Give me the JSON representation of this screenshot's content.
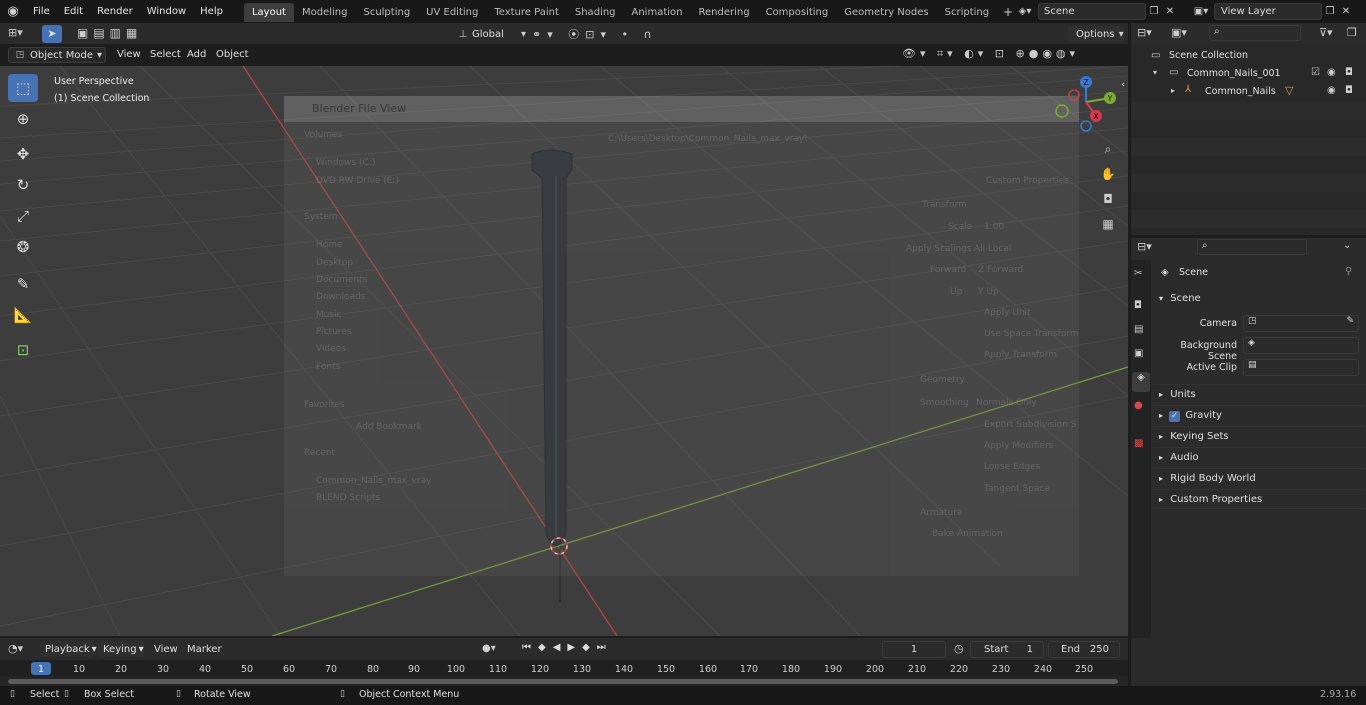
{
  "topbar": {
    "menus": [
      "File",
      "Edit",
      "Render",
      "Window",
      "Help"
    ],
    "workspaces": [
      "Layout",
      "Modeling",
      "Sculpting",
      "UV Editing",
      "Texture Paint",
      "Shading",
      "Animation",
      "Rendering",
      "Compositing",
      "Geometry Nodes",
      "Scripting"
    ],
    "active_workspace": "Layout",
    "scene": "Scene",
    "view_layer": "View Layer"
  },
  "viewport_header": {
    "mode": "Object Mode",
    "menus": [
      "View",
      "Select",
      "Add",
      "Object"
    ],
    "transform_orientation": "Global",
    "options": "Options"
  },
  "viewport": {
    "perspective": "User Perspective",
    "collection": "(1) Scene Collection",
    "gizmo": {
      "x": "X",
      "y": "Y",
      "z": "Z"
    }
  },
  "file_view_overlay": {
    "title": "Blender File View",
    "path": "C:\\Users\\Desktop\\Common_Nails_max_vray\\",
    "volumes_header": "Volumes",
    "volumes": [
      "Windows (C:)",
      "DVD RW Drive (E:)"
    ],
    "system_header": "System",
    "system": [
      "Home",
      "Desktop",
      "Documents",
      "Downloads",
      "Music",
      "Pictures",
      "Videos",
      "Fonts"
    ],
    "favorites_header": "Favorites",
    "add_bookmark": "Add Bookmark",
    "recent_header": "Recent",
    "recent": [
      "Common_Nails_max_vray",
      "BLEND Scripts"
    ],
    "options": [
      "Custom Properties",
      "Transform",
      "Scale",
      "Apply Scalings",
      "Forward",
      "Up",
      "Apply Unit",
      "Use Space Transform",
      "Apply Transform",
      "Geometry",
      "Smoothing",
      "Export Subdivision S",
      "Apply Modifiers",
      "Loose Edges",
      "Tangent Space",
      "Armature",
      "Bake Animation"
    ],
    "option_values": [
      "1.00",
      "All Local",
      "Z Forward",
      "Y Up",
      "Normals Only"
    ]
  },
  "outliner": {
    "root": "Scene Collection",
    "collection": "Common_Nails_001",
    "object": "Common_Nails"
  },
  "properties": {
    "context": "Scene",
    "panel": "Scene",
    "camera_label": "Camera",
    "background_scene_label": "Background Scene",
    "active_clip_label": "Active Clip",
    "sections": [
      "Units",
      "Gravity",
      "Keying Sets",
      "Audio",
      "Rigid Body World",
      "Custom Properties"
    ],
    "gravity_checked": true
  },
  "timeline": {
    "menus": [
      "Playback",
      "Keying",
      "View",
      "Marker"
    ],
    "current_frame": "1",
    "start_label": "Start",
    "start": "1",
    "end_label": "End",
    "end": "250",
    "ticks": [
      "1",
      "10",
      "20",
      "30",
      "40",
      "50",
      "60",
      "70",
      "80",
      "90",
      "100",
      "110",
      "120",
      "130",
      "140",
      "150",
      "160",
      "170",
      "180",
      "190",
      "200",
      "210",
      "220",
      "230",
      "240",
      "250"
    ]
  },
  "statusbar": {
    "select": "Select",
    "box_select": "Box Select",
    "rotate_view": "Rotate View",
    "context_menu": "Object Context Menu",
    "version": "2.93.16"
  }
}
